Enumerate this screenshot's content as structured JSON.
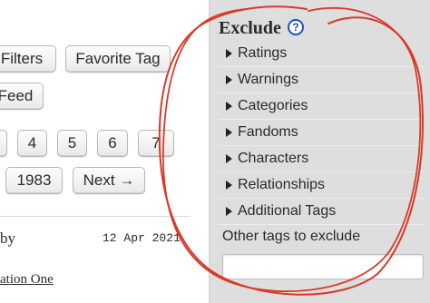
{
  "main": {
    "buttons": {
      "filters": "Filters",
      "favorite_tag": "Favorite Tag",
      "feed": "Feed",
      "next": "Next →"
    },
    "pagination": [
      "4",
      "5",
      "6",
      "7"
    ],
    "last_page": "1983",
    "work": {
      "by_label": "by",
      "date": "12 Apr 2021",
      "fandom_link": "ation One"
    }
  },
  "sidebar": {
    "heading": "Exclude",
    "help_glyph": "?",
    "filters": [
      "Ratings",
      "Warnings",
      "Categories",
      "Fandoms",
      "Characters",
      "Relationships",
      "Additional Tags"
    ],
    "other_tags_label": "Other tags to exclude",
    "other_tags_value": "",
    "icons": {
      "help": "help-question-icon",
      "expand": "triangle-right-icon"
    }
  },
  "colors": {
    "sidebar_bg": "#dedede",
    "annotation_circle": "#d8392b",
    "help_icon": "#1f4fbf"
  }
}
